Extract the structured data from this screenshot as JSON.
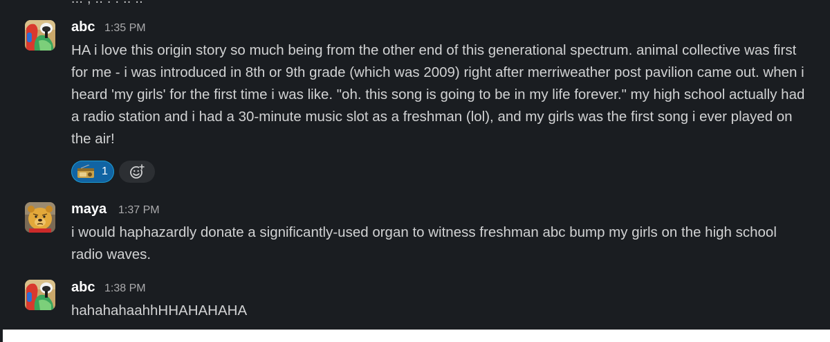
{
  "top_cut_text": "...  ,     ..  .       .     ..  ..",
  "messages": [
    {
      "author": "abc",
      "time": "1:35 PM",
      "text": "HA i love this origin story so much being from the other end of this generational spectrum. animal collective was first for me - i was introduced in 8th or 9th grade (which was 2009) right after merriweather post pavilion came out. when i heard 'my girls' for the first time i was like. \"oh. this song is going to be in my life forever.\" my high school actually had a radio station and i had a 30-minute music slot as a freshman (lol), and my girls was the first song i ever played on the air!",
      "reaction": {
        "emoji": "radio-emoji",
        "count": "1"
      }
    },
    {
      "author": "maya",
      "time": "1:37 PM",
      "text": "i would haphazardly donate a significantly-used organ to witness freshman abc bump my girls on the high school radio waves."
    },
    {
      "author": "abc",
      "time": "1:38 PM",
      "text": "hahahahaahhHHAHAHAHA"
    }
  ],
  "add_reaction_icon": "add-reaction-icon",
  "colors": {
    "background": "#1a1d21",
    "text": "#d1d2d3",
    "timestamp": "#ababad",
    "reaction_bg": "#1164a3",
    "reaction_border": "#1d9bd1"
  }
}
